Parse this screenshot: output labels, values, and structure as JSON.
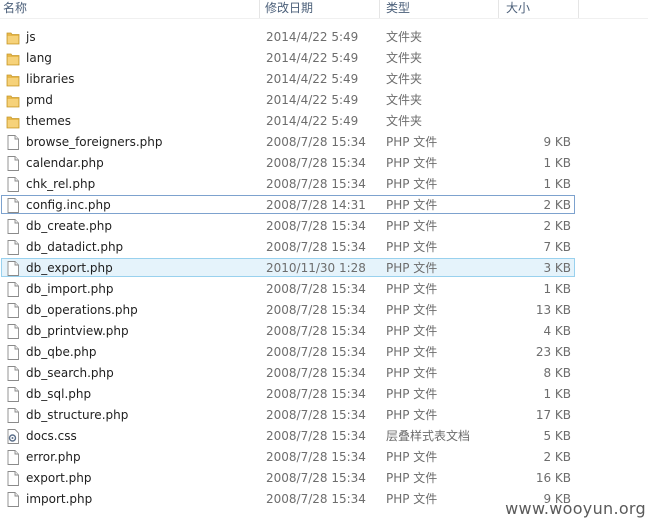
{
  "columns": {
    "name": "名称",
    "modified": "修改日期",
    "type": "类型",
    "size": "大小"
  },
  "files": [
    {
      "name": "js",
      "modified": "2014/4/22 5:49",
      "type": "文件夹",
      "size": "",
      "icon": "folder-icon"
    },
    {
      "name": "lang",
      "modified": "2014/4/22 5:49",
      "type": "文件夹",
      "size": "",
      "icon": "folder-icon"
    },
    {
      "name": "libraries",
      "modified": "2014/4/22 5:49",
      "type": "文件夹",
      "size": "",
      "icon": "folder-icon"
    },
    {
      "name": "pmd",
      "modified": "2014/4/22 5:49",
      "type": "文件夹",
      "size": "",
      "icon": "folder-icon"
    },
    {
      "name": "themes",
      "modified": "2014/4/22 5:49",
      "type": "文件夹",
      "size": "",
      "icon": "folder-icon"
    },
    {
      "name": "browse_foreigners.php",
      "modified": "2008/7/28 15:34",
      "type": "PHP 文件",
      "size": "9 KB",
      "icon": "file-icon"
    },
    {
      "name": "calendar.php",
      "modified": "2008/7/28 15:34",
      "type": "PHP 文件",
      "size": "1 KB",
      "icon": "file-icon"
    },
    {
      "name": "chk_rel.php",
      "modified": "2008/7/28 15:34",
      "type": "PHP 文件",
      "size": "1 KB",
      "icon": "file-icon"
    },
    {
      "name": "config.inc.php",
      "modified": "2008/7/28 14:31",
      "type": "PHP 文件",
      "size": "2 KB",
      "icon": "file-icon",
      "state": "focused"
    },
    {
      "name": "db_create.php",
      "modified": "2008/7/28 15:34",
      "type": "PHP 文件",
      "size": "2 KB",
      "icon": "file-icon"
    },
    {
      "name": "db_datadict.php",
      "modified": "2008/7/28 15:34",
      "type": "PHP 文件",
      "size": "7 KB",
      "icon": "file-icon"
    },
    {
      "name": "db_export.php",
      "modified": "2010/11/30 1:28",
      "type": "PHP 文件",
      "size": "3 KB",
      "icon": "file-icon",
      "state": "selected"
    },
    {
      "name": "db_import.php",
      "modified": "2008/7/28 15:34",
      "type": "PHP 文件",
      "size": "1 KB",
      "icon": "file-icon"
    },
    {
      "name": "db_operations.php",
      "modified": "2008/7/28 15:34",
      "type": "PHP 文件",
      "size": "13 KB",
      "icon": "file-icon"
    },
    {
      "name": "db_printview.php",
      "modified": "2008/7/28 15:34",
      "type": "PHP 文件",
      "size": "4 KB",
      "icon": "file-icon"
    },
    {
      "name": "db_qbe.php",
      "modified": "2008/7/28 15:34",
      "type": "PHP 文件",
      "size": "23 KB",
      "icon": "file-icon"
    },
    {
      "name": "db_search.php",
      "modified": "2008/7/28 15:34",
      "type": "PHP 文件",
      "size": "8 KB",
      "icon": "file-icon"
    },
    {
      "name": "db_sql.php",
      "modified": "2008/7/28 15:34",
      "type": "PHP 文件",
      "size": "1 KB",
      "icon": "file-icon"
    },
    {
      "name": "db_structure.php",
      "modified": "2008/7/28 15:34",
      "type": "PHP 文件",
      "size": "17 KB",
      "icon": "file-icon"
    },
    {
      "name": "docs.css",
      "modified": "2008/7/28 15:34",
      "type": "层叠样式表文档",
      "size": "5 KB",
      "icon": "css-file-icon"
    },
    {
      "name": "error.php",
      "modified": "2008/7/28 15:34",
      "type": "PHP 文件",
      "size": "2 KB",
      "icon": "file-icon"
    },
    {
      "name": "export.php",
      "modified": "2008/7/28 15:34",
      "type": "PHP 文件",
      "size": "16 KB",
      "icon": "file-icon"
    },
    {
      "name": "import.php",
      "modified": "2008/7/28 15:34",
      "type": "PHP 文件",
      "size": "9 KB",
      "icon": "file-icon"
    }
  ],
  "watermark": "www.wooyun.org",
  "colors": {
    "header_text": "#4c607a",
    "selected_bg": "#e5f3fb",
    "selected_border": "#99d1ee",
    "focus_border": "#7da2ce",
    "folder": "#e8b84a"
  }
}
